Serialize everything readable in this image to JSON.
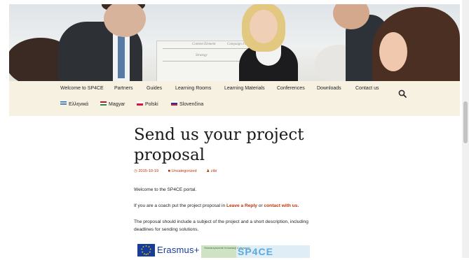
{
  "nav": {
    "primary": [
      {
        "label": "Welcome to SP4CE"
      },
      {
        "label": "Partners"
      },
      {
        "label": "Guides"
      },
      {
        "label": "Learning Rooms"
      },
      {
        "label": "Learning Materials"
      },
      {
        "label": "Conferences"
      },
      {
        "label": "Downloads"
      },
      {
        "label": "Contact us"
      }
    ],
    "languages": [
      {
        "label": "Ελληνικά",
        "flag": "greece-flag"
      },
      {
        "label": "Magyar",
        "flag": "hungary-flag"
      },
      {
        "label": "Polski",
        "flag": "poland-flag"
      },
      {
        "label": "Slovenčina",
        "flag": "slovenia-flag"
      }
    ],
    "search_icon": "search-icon"
  },
  "header": {
    "board_text_1": "Content Element",
    "board_text_2": "Campaign Factors",
    "board_text_3": "Strategy"
  },
  "post": {
    "title": "Send us your project proposal",
    "date": "2015-10-19",
    "category": "Uncategorized",
    "author": "zibi",
    "paragraph1": "Welcome to the SP4CE portal.",
    "paragraph2_before": "If you are a coach put the project proposal in ",
    "paragraph2_link1": "Leave a Reply",
    "paragraph2_mid": " or ",
    "paragraph2_link2": "contact with us.",
    "paragraph3_line1": "The proposal should include a subject of the project and a short description, including",
    "paragraph3_line2": "deadlines for sending solutions."
  },
  "logos": {
    "erasmus": "Erasmus+",
    "sp4ce": "SP4CE",
    "partner_text": "Stowarzyszenie Innowacji Cyfrowych"
  },
  "colors": {
    "accent": "#bc360a",
    "nav_bg": "#f7f1e2"
  }
}
